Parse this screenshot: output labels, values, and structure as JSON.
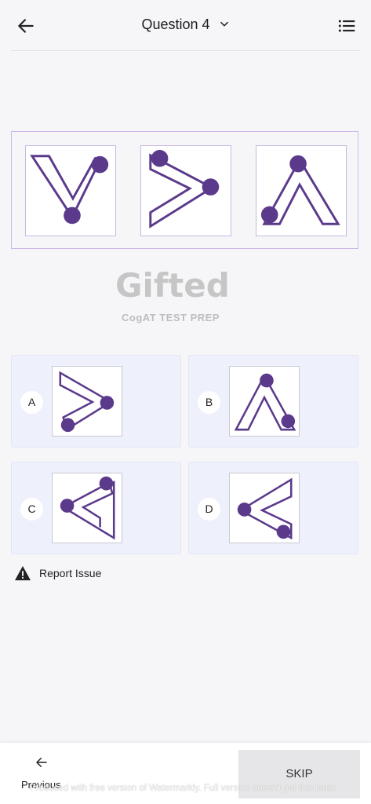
{
  "header": {
    "title": "Question 4",
    "back_icon": "arrow-left-icon",
    "dropdown_icon": "chevron-down-icon",
    "menu_icon": "list-icon"
  },
  "question": {
    "figures": [
      "v-shape-dot-bottom",
      "arrow-right-dot-top",
      "lambda-dot-top"
    ]
  },
  "logo": {
    "brand": "Gifted",
    "tagline": "CogAT TEST PREP"
  },
  "options": [
    {
      "letter": "A",
      "figure": "arrow-right-dot-bottom"
    },
    {
      "letter": "B",
      "figure": "lambda-dot-top"
    },
    {
      "letter": "C",
      "figure": "arrow-left-dot-top"
    },
    {
      "letter": "D",
      "figure": "arrow-left-dot-bottom"
    }
  ],
  "report": {
    "label": "Report Issue",
    "icon": "warning-icon"
  },
  "footer": {
    "previous_label": "Previous",
    "skip_label": "SKIP",
    "watermark_text": "Produced with free version of Watermarkly. Full version doesn't put this mark."
  },
  "colors": {
    "shape_purple": "#5b3a8c",
    "option_bg": "#eef0fb",
    "page_bg": "#f6f6f9"
  }
}
